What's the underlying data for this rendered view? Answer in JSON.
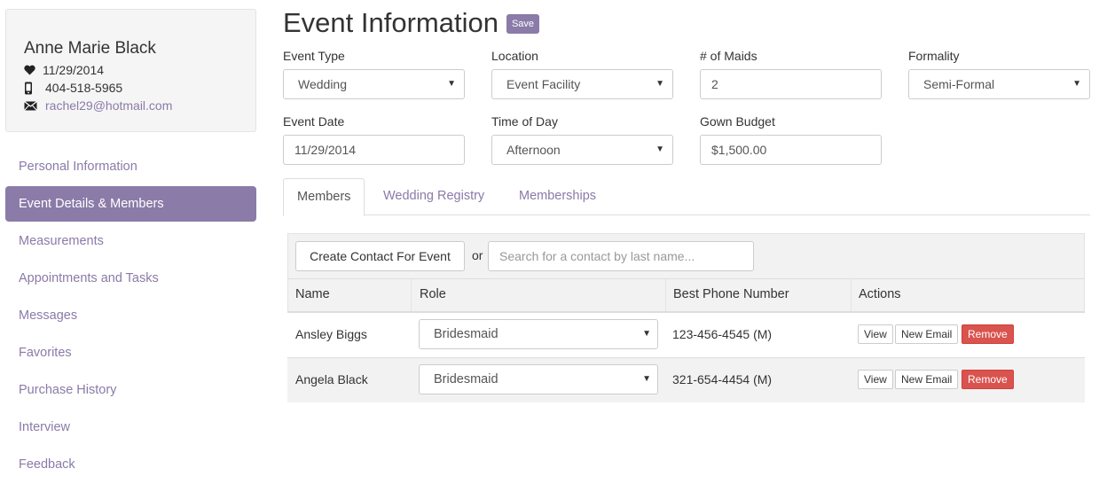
{
  "contact": {
    "name": "Anne Marie Black",
    "event_date": "11/29/2014",
    "phone": "404-518-5965",
    "email": "rachel29@hotmail.com"
  },
  "sidebar": {
    "items": [
      {
        "label": "Personal Information"
      },
      {
        "label": "Event Details & Members",
        "active": true
      },
      {
        "label": "Measurements"
      },
      {
        "label": "Appointments and Tasks"
      },
      {
        "label": "Messages"
      },
      {
        "label": "Favorites"
      },
      {
        "label": "Purchase History"
      },
      {
        "label": "Interview"
      },
      {
        "label": "Feedback"
      }
    ]
  },
  "header": {
    "title": "Event Information",
    "save_label": "Save"
  },
  "form": {
    "event_type": {
      "label": "Event Type",
      "value": "Wedding"
    },
    "location": {
      "label": "Location",
      "value": "Event Facility"
    },
    "maids": {
      "label": "# of Maids",
      "value": "2"
    },
    "formality": {
      "label": "Formality",
      "value": "Semi-Formal"
    },
    "event_date": {
      "label": "Event Date",
      "value": "11/29/2014"
    },
    "time_of_day": {
      "label": "Time of Day",
      "value": "Afternoon"
    },
    "gown_budget": {
      "label": "Gown Budget",
      "value": "$1,500.00"
    }
  },
  "tabs": [
    {
      "label": "Members",
      "active": true
    },
    {
      "label": "Wedding Registry"
    },
    {
      "label": "Memberships"
    }
  ],
  "members": {
    "create_label": "Create Contact For Event",
    "or_label": "or",
    "search_placeholder": "Search for a contact by last name...",
    "columns": [
      "Name",
      "Role",
      "Best Phone Number",
      "Actions"
    ],
    "rows": [
      {
        "name": "Ansley Biggs",
        "role": "Bridesmaid",
        "phone": "123-456-4545 (M)"
      },
      {
        "name": "Angela Black",
        "role": "Bridesmaid",
        "phone": "321-654-4454 (M)"
      }
    ],
    "actions": {
      "view": "View",
      "new_email": "New Email",
      "remove": "Remove"
    }
  },
  "colors": {
    "accent": "#8b7ba8",
    "link": "#8b7aa8",
    "danger": "#d9534f"
  },
  "icons": {
    "heart": "heart-icon",
    "phone": "mobile-phone-icon",
    "email": "envelope-icon",
    "caret": "caret-down-icon"
  }
}
